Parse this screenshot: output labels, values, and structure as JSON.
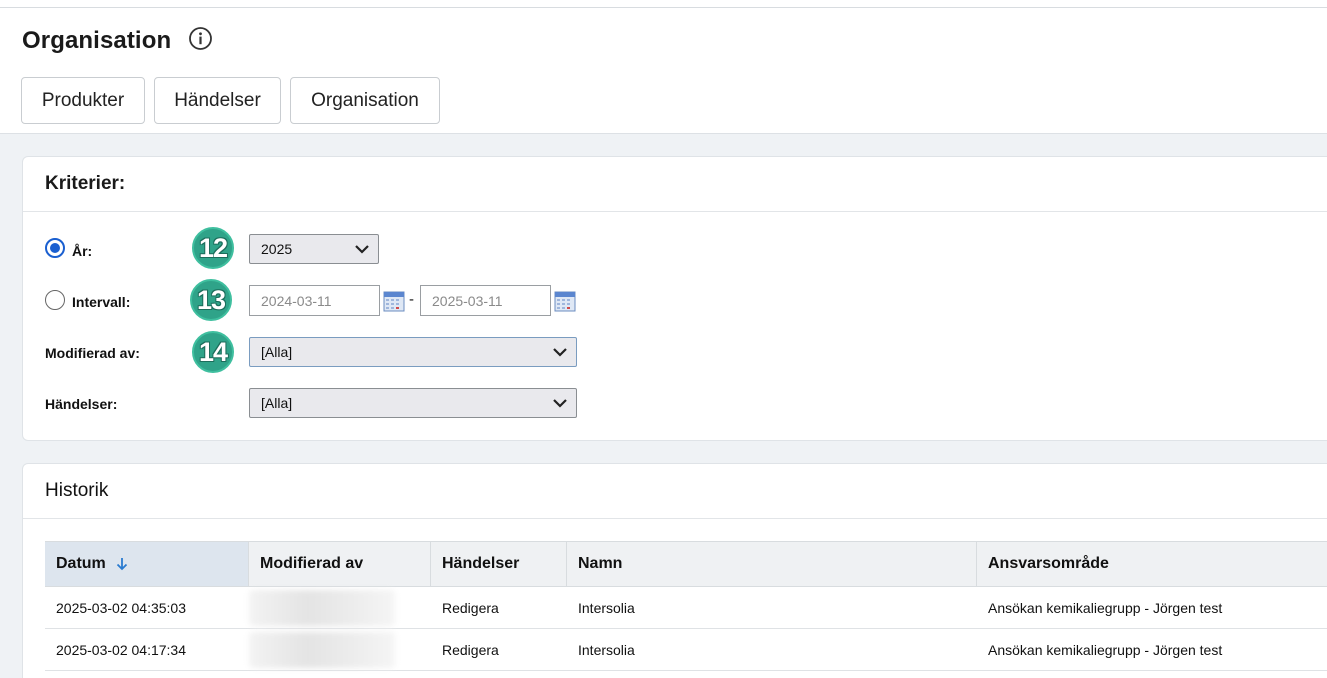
{
  "page": {
    "title": "Organisation",
    "info_icon": "info-circle-icon"
  },
  "tabs": [
    {
      "label": "Produkter"
    },
    {
      "label": "Händelser"
    },
    {
      "label": "Organisation"
    }
  ],
  "criteria": {
    "heading": "Kriterier:",
    "year": {
      "label": "År:",
      "selected": true,
      "value": "2025",
      "badge": "12"
    },
    "interval": {
      "label": "Intervall:",
      "selected": false,
      "from_placeholder": "2024-03-11",
      "to_placeholder": "2025-03-11",
      "separator": "-",
      "badge": "13",
      "calendar_icon": "calendar-icon"
    },
    "modified_by": {
      "label": "Modifierad av:",
      "value": "[Alla]",
      "badge": "14"
    },
    "events": {
      "label": "Händelser:",
      "value": "[Alla]"
    }
  },
  "history": {
    "heading": "Historik",
    "columns": [
      "Datum",
      "Modifierad av",
      "Händelser",
      "Namn",
      "Ansvarsområde"
    ],
    "sorted_column": "Datum",
    "sort_direction": "descending",
    "rows": [
      {
        "datum": "2025-03-02 04:35:03",
        "modifierad_av": "",
        "handelser": "Redigera",
        "namn": "Intersolia",
        "ansvarsomrade": "Ansökan kemikaliegrupp - Jörgen test"
      },
      {
        "datum": "2025-03-02 04:17:34",
        "modifierad_av": "",
        "handelser": "Redigera",
        "namn": "Intersolia",
        "ansvarsomrade": "Ansökan kemikaliegrupp - Jörgen test"
      }
    ]
  },
  "colors": {
    "accent": "#1a5fd0",
    "badge": "#2fa389",
    "background": "#eff2f5"
  }
}
